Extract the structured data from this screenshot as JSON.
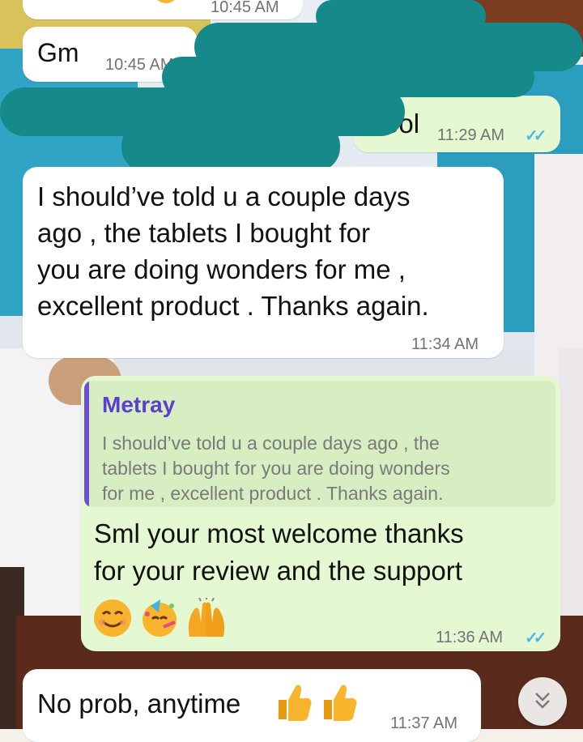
{
  "messages": [
    {
      "direction": "incoming",
      "text": "",
      "time": "10:45 AM"
    },
    {
      "direction": "incoming",
      "text": "Gm",
      "time": "10:45 AM"
    },
    {
      "direction": "outgoing",
      "text": "Kool",
      "time": "11:29 AM",
      "status": "read"
    },
    {
      "direction": "incoming",
      "lines": [
        "I should’ve told u a couple days",
        "ago , the tablets I bought for",
        "you  are doing wonders for me ,",
        "excellent product . Thanks again."
      ],
      "time": "11:34 AM"
    },
    {
      "direction": "outgoing",
      "reply_to": {
        "name": "Metray",
        "lines": [
          "I should’ve told u a couple days ago , the",
          "tablets I bought for you  are doing wonders",
          "for me , excellent product . Thanks again."
        ]
      },
      "lines": [
        "Sml your most welcome thanks",
        "for your review and the support"
      ],
      "emojis": [
        "smiling-face",
        "partying-face",
        "raising-hands"
      ],
      "time": "11:36 AM",
      "status": "read"
    },
    {
      "direction": "incoming",
      "text": "No prob, anytime",
      "emojis": [
        "thumbs-up",
        "thumbs-up"
      ],
      "time": "11:37 AM"
    }
  ],
  "colors": {
    "incoming_bubble": "#ffffff",
    "outgoing_bubble": "#e4f8d2",
    "read_ticks": "#4fb6ec",
    "reply_bar": "#6e4fd0",
    "redaction": "#16898b"
  },
  "scroll_button": {
    "icon": "double-chevron-down-icon"
  }
}
